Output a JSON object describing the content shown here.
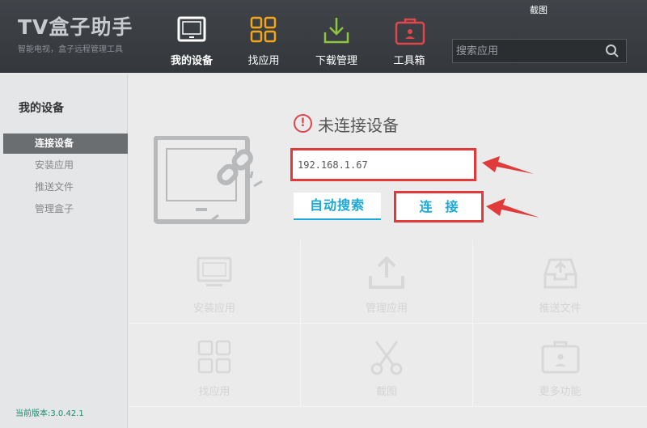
{
  "app": {
    "title": "TV盒子助手",
    "subtitle": "智能电视，盒子远程管理工具",
    "screenshot_link": "截图"
  },
  "nav": {
    "items": [
      {
        "label": "我的设备",
        "icon": "tablet-icon",
        "color": "#ffffff",
        "active": true
      },
      {
        "label": "找应用",
        "icon": "grid-icon",
        "color": "#f2a71b",
        "active": false
      },
      {
        "label": "下载管理",
        "icon": "download-icon",
        "color": "#8cc63f",
        "active": false
      },
      {
        "label": "工具箱",
        "icon": "toolbox-icon",
        "color": "#e0474c",
        "active": false
      }
    ]
  },
  "search": {
    "placeholder": "搜索应用"
  },
  "sidebar": {
    "title": "我的设备",
    "items": [
      {
        "label": "连接设备",
        "active": true
      },
      {
        "label": "安装应用",
        "active": false
      },
      {
        "label": "推送文件",
        "active": false
      },
      {
        "label": "管理盒子",
        "active": false
      }
    ],
    "version": "当前版本:3.0.42.1"
  },
  "main": {
    "status_text": "未连接设备",
    "ip_value": "192.168.1.67",
    "auto_search_label": "自动搜索",
    "connect_label": "连接"
  },
  "grid": {
    "items": [
      {
        "label": "安装应用",
        "icon": "monitor-icon"
      },
      {
        "label": "管理应用",
        "icon": "upload-tray-icon"
      },
      {
        "label": "推送文件",
        "icon": "inbox-push-icon"
      },
      {
        "label": "找应用",
        "icon": "grid-icon"
      },
      {
        "label": "截图",
        "icon": "scissors-icon"
      },
      {
        "label": "更多功能",
        "icon": "briefcase-icon"
      }
    ]
  },
  "colors": {
    "accent": "#1aa9d9",
    "highlight_red": "#e03a3a",
    "version_green": "#1a8c6e"
  }
}
